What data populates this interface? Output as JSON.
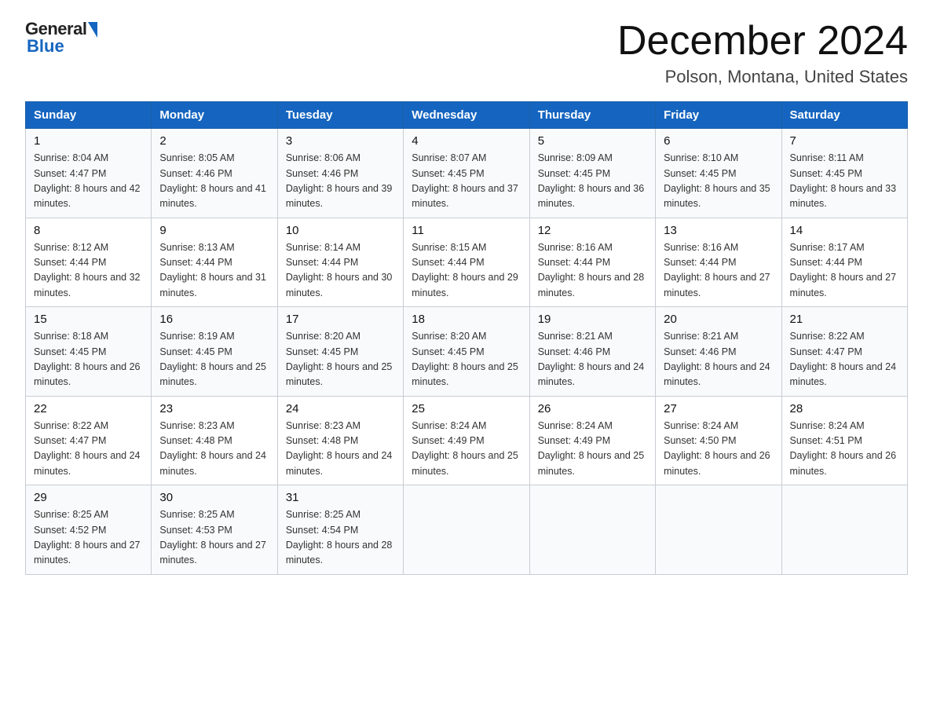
{
  "logo": {
    "general": "General",
    "blue": "Blue"
  },
  "title": "December 2024",
  "subtitle": "Polson, Montana, United States",
  "weekdays": [
    "Sunday",
    "Monday",
    "Tuesday",
    "Wednesday",
    "Thursday",
    "Friday",
    "Saturday"
  ],
  "weeks": [
    [
      {
        "day": "1",
        "sunrise": "8:04 AM",
        "sunset": "4:47 PM",
        "daylight": "8 hours and 42 minutes."
      },
      {
        "day": "2",
        "sunrise": "8:05 AM",
        "sunset": "4:46 PM",
        "daylight": "8 hours and 41 minutes."
      },
      {
        "day": "3",
        "sunrise": "8:06 AM",
        "sunset": "4:46 PM",
        "daylight": "8 hours and 39 minutes."
      },
      {
        "day": "4",
        "sunrise": "8:07 AM",
        "sunset": "4:45 PM",
        "daylight": "8 hours and 37 minutes."
      },
      {
        "day": "5",
        "sunrise": "8:09 AM",
        "sunset": "4:45 PM",
        "daylight": "8 hours and 36 minutes."
      },
      {
        "day": "6",
        "sunrise": "8:10 AM",
        "sunset": "4:45 PM",
        "daylight": "8 hours and 35 minutes."
      },
      {
        "day": "7",
        "sunrise": "8:11 AM",
        "sunset": "4:45 PM",
        "daylight": "8 hours and 33 minutes."
      }
    ],
    [
      {
        "day": "8",
        "sunrise": "8:12 AM",
        "sunset": "4:44 PM",
        "daylight": "8 hours and 32 minutes."
      },
      {
        "day": "9",
        "sunrise": "8:13 AM",
        "sunset": "4:44 PM",
        "daylight": "8 hours and 31 minutes."
      },
      {
        "day": "10",
        "sunrise": "8:14 AM",
        "sunset": "4:44 PM",
        "daylight": "8 hours and 30 minutes."
      },
      {
        "day": "11",
        "sunrise": "8:15 AM",
        "sunset": "4:44 PM",
        "daylight": "8 hours and 29 minutes."
      },
      {
        "day": "12",
        "sunrise": "8:16 AM",
        "sunset": "4:44 PM",
        "daylight": "8 hours and 28 minutes."
      },
      {
        "day": "13",
        "sunrise": "8:16 AM",
        "sunset": "4:44 PM",
        "daylight": "8 hours and 27 minutes."
      },
      {
        "day": "14",
        "sunrise": "8:17 AM",
        "sunset": "4:44 PM",
        "daylight": "8 hours and 27 minutes."
      }
    ],
    [
      {
        "day": "15",
        "sunrise": "8:18 AM",
        "sunset": "4:45 PM",
        "daylight": "8 hours and 26 minutes."
      },
      {
        "day": "16",
        "sunrise": "8:19 AM",
        "sunset": "4:45 PM",
        "daylight": "8 hours and 25 minutes."
      },
      {
        "day": "17",
        "sunrise": "8:20 AM",
        "sunset": "4:45 PM",
        "daylight": "8 hours and 25 minutes."
      },
      {
        "day": "18",
        "sunrise": "8:20 AM",
        "sunset": "4:45 PM",
        "daylight": "8 hours and 25 minutes."
      },
      {
        "day": "19",
        "sunrise": "8:21 AM",
        "sunset": "4:46 PM",
        "daylight": "8 hours and 24 minutes."
      },
      {
        "day": "20",
        "sunrise": "8:21 AM",
        "sunset": "4:46 PM",
        "daylight": "8 hours and 24 minutes."
      },
      {
        "day": "21",
        "sunrise": "8:22 AM",
        "sunset": "4:47 PM",
        "daylight": "8 hours and 24 minutes."
      }
    ],
    [
      {
        "day": "22",
        "sunrise": "8:22 AM",
        "sunset": "4:47 PM",
        "daylight": "8 hours and 24 minutes."
      },
      {
        "day": "23",
        "sunrise": "8:23 AM",
        "sunset": "4:48 PM",
        "daylight": "8 hours and 24 minutes."
      },
      {
        "day": "24",
        "sunrise": "8:23 AM",
        "sunset": "4:48 PM",
        "daylight": "8 hours and 24 minutes."
      },
      {
        "day": "25",
        "sunrise": "8:24 AM",
        "sunset": "4:49 PM",
        "daylight": "8 hours and 25 minutes."
      },
      {
        "day": "26",
        "sunrise": "8:24 AM",
        "sunset": "4:49 PM",
        "daylight": "8 hours and 25 minutes."
      },
      {
        "day": "27",
        "sunrise": "8:24 AM",
        "sunset": "4:50 PM",
        "daylight": "8 hours and 26 minutes."
      },
      {
        "day": "28",
        "sunrise": "8:24 AM",
        "sunset": "4:51 PM",
        "daylight": "8 hours and 26 minutes."
      }
    ],
    [
      {
        "day": "29",
        "sunrise": "8:25 AM",
        "sunset": "4:52 PM",
        "daylight": "8 hours and 27 minutes."
      },
      {
        "day": "30",
        "sunrise": "8:25 AM",
        "sunset": "4:53 PM",
        "daylight": "8 hours and 27 minutes."
      },
      {
        "day": "31",
        "sunrise": "8:25 AM",
        "sunset": "4:54 PM",
        "daylight": "8 hours and 28 minutes."
      },
      null,
      null,
      null,
      null
    ]
  ]
}
